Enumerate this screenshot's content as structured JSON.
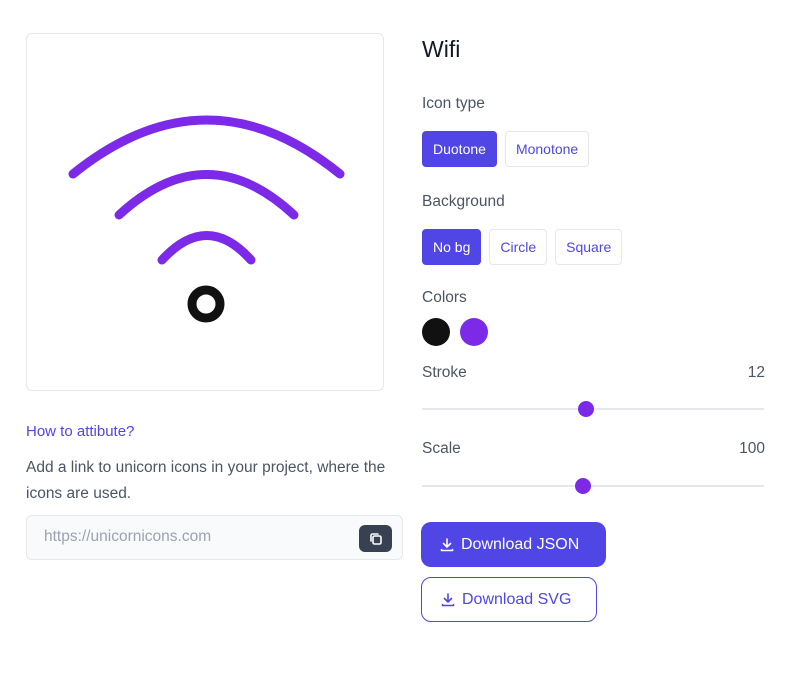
{
  "icon": {
    "name": "Wifi",
    "primary_color": "#7c2ae8",
    "secondary_color": "#111111"
  },
  "controls": {
    "icon_type_label": "Icon type",
    "icon_type_options": [
      "Duotone",
      "Monotone"
    ],
    "icon_type_selected": "Duotone",
    "background_label": "Background",
    "background_options": [
      "No bg",
      "Circle",
      "Square"
    ],
    "background_selected": "No bg",
    "colors_label": "Colors",
    "colors": [
      "#111111",
      "#7c2ae8"
    ],
    "stroke": {
      "label": "Stroke",
      "value": "12",
      "fraction": 0.48
    },
    "scale": {
      "label": "Scale",
      "value": "100",
      "fraction": 0.47
    }
  },
  "attribution": {
    "link_text": "How to attibute?",
    "description": "Add a link to unicorn icons in your project, where the icons are used.",
    "url_placeholder": "https://unicornicons.com"
  },
  "actions": {
    "download_json": "Download JSON",
    "download_svg": "Download SVG"
  }
}
